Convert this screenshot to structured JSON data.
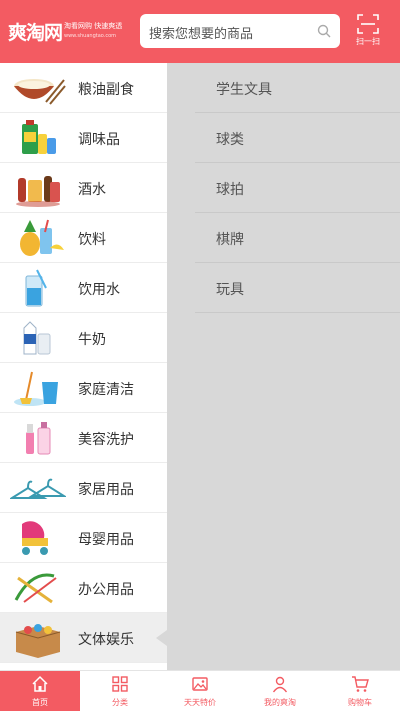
{
  "header": {
    "logo_main": "爽淘网",
    "logo_tagline": "淘看网购 快速爽透",
    "logo_url": "www.shuangtao.com",
    "search_placeholder": "搜索您想要的商品",
    "scan_label": "扫一扫"
  },
  "categories": [
    {
      "label": "粮油副食",
      "icon": "grain-oil-icon"
    },
    {
      "label": "调味品",
      "icon": "seasoning-icon"
    },
    {
      "label": "酒水",
      "icon": "liquor-icon"
    },
    {
      "label": "饮料",
      "icon": "beverage-icon"
    },
    {
      "label": "饮用水",
      "icon": "water-icon"
    },
    {
      "label": "牛奶",
      "icon": "milk-icon"
    },
    {
      "label": "家庭清洁",
      "icon": "cleaning-icon"
    },
    {
      "label": "美容洗护",
      "icon": "beauty-icon"
    },
    {
      "label": "家居用品",
      "icon": "hanger-icon"
    },
    {
      "label": "母婴用品",
      "icon": "stroller-icon"
    },
    {
      "label": "办公用品",
      "icon": "office-icon"
    },
    {
      "label": "文体娱乐",
      "icon": "toys-box-icon"
    }
  ],
  "active_category_index": 11,
  "subcategories": [
    "学生文具",
    "球类",
    "球拍",
    "棋牌",
    "玩具"
  ],
  "tabs": [
    {
      "label": "首页",
      "icon": "home-icon"
    },
    {
      "label": "分类",
      "icon": "grid-icon"
    },
    {
      "label": "天天特价",
      "icon": "picture-icon"
    },
    {
      "label": "我的爽淘",
      "icon": "user-icon"
    },
    {
      "label": "购物车",
      "icon": "cart-icon"
    }
  ],
  "active_tab_index": 0,
  "colors": {
    "brand": "#f35b62",
    "left_active_bg": "#eeeeee",
    "right_panel_bg": "#d8d8d8"
  }
}
